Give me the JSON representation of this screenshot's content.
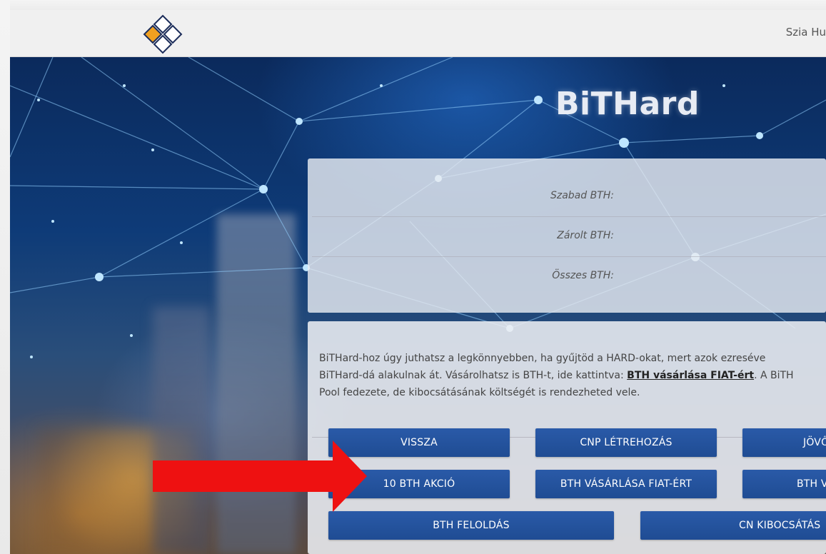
{
  "header": {
    "greeting": "Szia Hu"
  },
  "hero": {
    "title": "BiTHard"
  },
  "balances": [
    {
      "label": "Szabad BTH:"
    },
    {
      "label": "Zárolt BTH:"
    },
    {
      "label": "Összes BTH:"
    }
  ],
  "info": {
    "line1": "BiTHard-hoz úgy juthatsz a legkönnyebben, ha gyűjtöd a HARD-okat, mert azok ezreséve",
    "line2_before": "BiTHard-dá alakulnak át. Vásárolhatsz is BTH-t, ide kattintva: ",
    "line2_link": "BTH vásárlása FIAT-ért",
    "line2_after": ". A BiTH",
    "line3": "Pool fedezete, de kibocsátásának költségét is rendezheted vele."
  },
  "buttons": {
    "back": "VISSZA",
    "cnp_create": "CNP LÉTREHOZÁS",
    "future_build": "JÖVŐÉPÍTÉ",
    "bth_promo": "10 BTH AKCIÓ",
    "buy_fiat": "BTH VÁSÁRLÁSA FIAT-ÉRT",
    "buy_other": "BTH VÁSÁRL",
    "unlock": "BTH FELOLDÁS",
    "cn_issue": "CN KIBOCSÁTÁS"
  },
  "colors": {
    "button_blue": "#1f4c93",
    "arrow_red": "#ee1111",
    "logo_orange": "#f0a020",
    "logo_navy": "#1c2d5a"
  }
}
